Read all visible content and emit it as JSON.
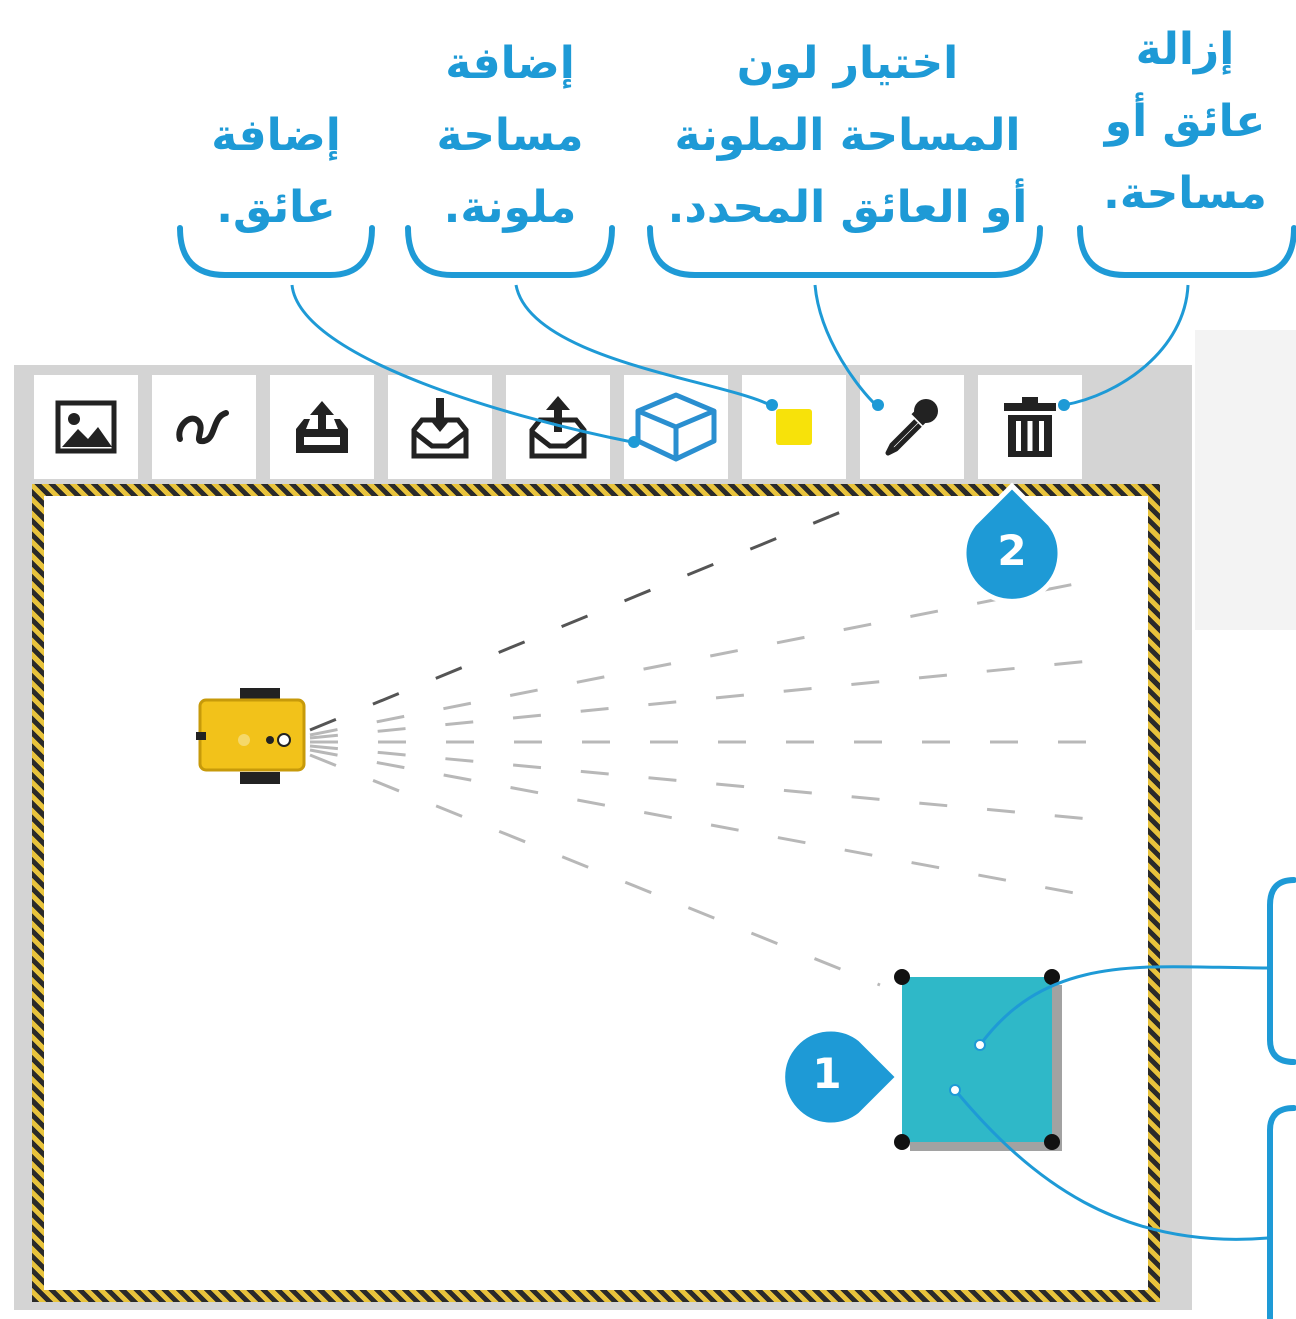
{
  "callouts": {
    "add_obstacle": [
      "إضافة",
      "عائق."
    ],
    "add_colored_area": [
      "إضافة",
      "مساحة",
      "ملونة."
    ],
    "choose_color": [
      "اختيار لون",
      "المساحة الملونة",
      "أو العائق المحدد."
    ],
    "remove": [
      "إزالة",
      "عائق أو",
      "مساحة."
    ]
  },
  "toolbar": {
    "tools": [
      {
        "name": "image-icon"
      },
      {
        "name": "path-icon"
      },
      {
        "name": "export-icon"
      },
      {
        "name": "import-icon"
      },
      {
        "name": "upload-icon"
      },
      {
        "name": "obstacle-cube-icon"
      },
      {
        "name": "color-swatch-icon"
      },
      {
        "name": "eyedropper-icon"
      },
      {
        "name": "trash-icon"
      }
    ]
  },
  "badges": {
    "one": "1",
    "two": "2"
  },
  "colors": {
    "accent": "#1e9ad6",
    "swatch": "#f7e20a",
    "obstacle": "#2fb8c8",
    "robot": "#f2c21a"
  }
}
